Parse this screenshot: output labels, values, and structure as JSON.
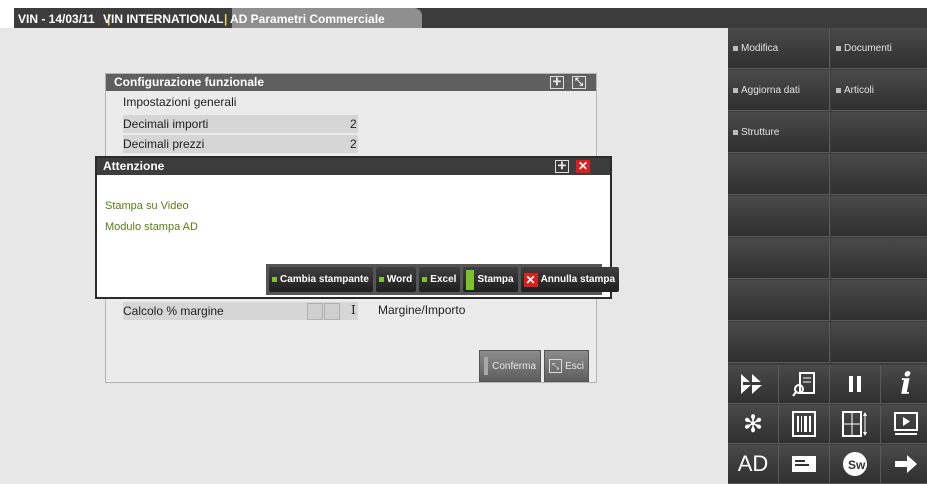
{
  "tabs": {
    "version": "VIN - 14/03/11",
    "company": "VIN INTERNATIONAL",
    "module": "AD Parametri Commerciale"
  },
  "right_menu": {
    "modifica": "Modifica",
    "documenti": "Documenti",
    "aggiorna_dati": "Aggiorna dati",
    "articoli": "Articoli",
    "strutture": "Strutture",
    "icon_ad": "AD"
  },
  "config": {
    "title": "Configurazione funzionale",
    "section": "Impostazioni generali",
    "decimali_importi_label": "Decimali importi",
    "decimali_importi_value": "2",
    "decimali_prezzi_label": "Decimali prezzi",
    "decimali_prezzi_value": "2",
    "calcolo_label": "Calcolo % margine",
    "calcolo_code": "I",
    "calcolo_value": "Margine/Importo",
    "conferma": "Conferma",
    "esci": "Esci"
  },
  "dialog": {
    "title": "Attenzione",
    "line1": "Stampa su Video",
    "line2": "Modulo stampa AD",
    "cambia_stampante": "Cambia stampante",
    "word": "Word",
    "excel": "Excel",
    "stampa": "Stampa",
    "annulla_stampa": "Annulla stampa"
  },
  "colors": {
    "accent_green": "#7cc32a",
    "close_red": "#d91f1f"
  }
}
